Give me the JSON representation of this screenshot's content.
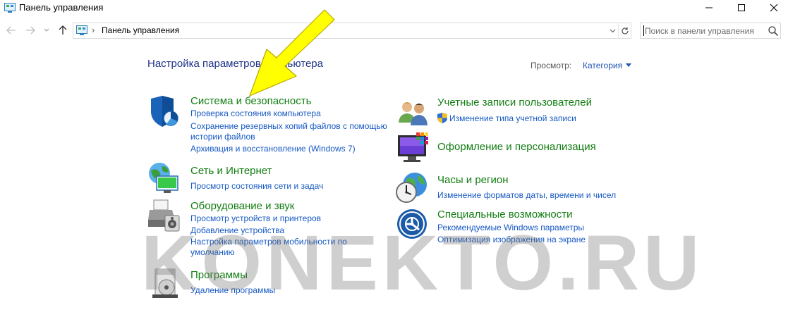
{
  "window": {
    "title": "Панель управления"
  },
  "address": {
    "path": "Панель управления"
  },
  "search": {
    "placeholder": "Поиск в панели управления"
  },
  "header": {
    "heading": "Настройка параметров компьютера",
    "view_label": "Просмотр:",
    "view_value": "Категория"
  },
  "categories": {
    "system": {
      "title": "Система и безопасность",
      "links": [
        "Проверка состояния компьютера",
        "Сохранение резервных копий файлов с помощью",
        "истории файлов",
        "Архивация и восстановление (Windows 7)"
      ]
    },
    "network": {
      "title": "Сеть и Интернет",
      "links": [
        "Просмотр состояния сети и задач"
      ]
    },
    "hardware": {
      "title": "Оборудование и звук",
      "links": [
        "Просмотр устройств и принтеров",
        "Добавление устройства",
        "Настройка параметров мобильности по",
        "умолчанию"
      ]
    },
    "programs": {
      "title": "Программы",
      "links": [
        "Удаление программы"
      ]
    },
    "accounts": {
      "title": "Учетные записи пользователей",
      "links": [
        "Изменение типа учетной записи"
      ]
    },
    "appearance": {
      "title": "Оформление и персонализация",
      "links": []
    },
    "clock": {
      "title": "Часы и регион",
      "links": [
        "Изменение форматов даты, времени и чисел"
      ]
    },
    "access": {
      "title": "Специальные возможности",
      "links": [
        "Рекомендуемые Windows параметры",
        "Оптимизация изображения на экране"
      ]
    }
  },
  "watermark": "KONEKTO.RU",
  "colors": {
    "category_title": "#127e12",
    "link": "#1659c4",
    "heading": "#1e3287",
    "arrow": "#ffff00"
  }
}
